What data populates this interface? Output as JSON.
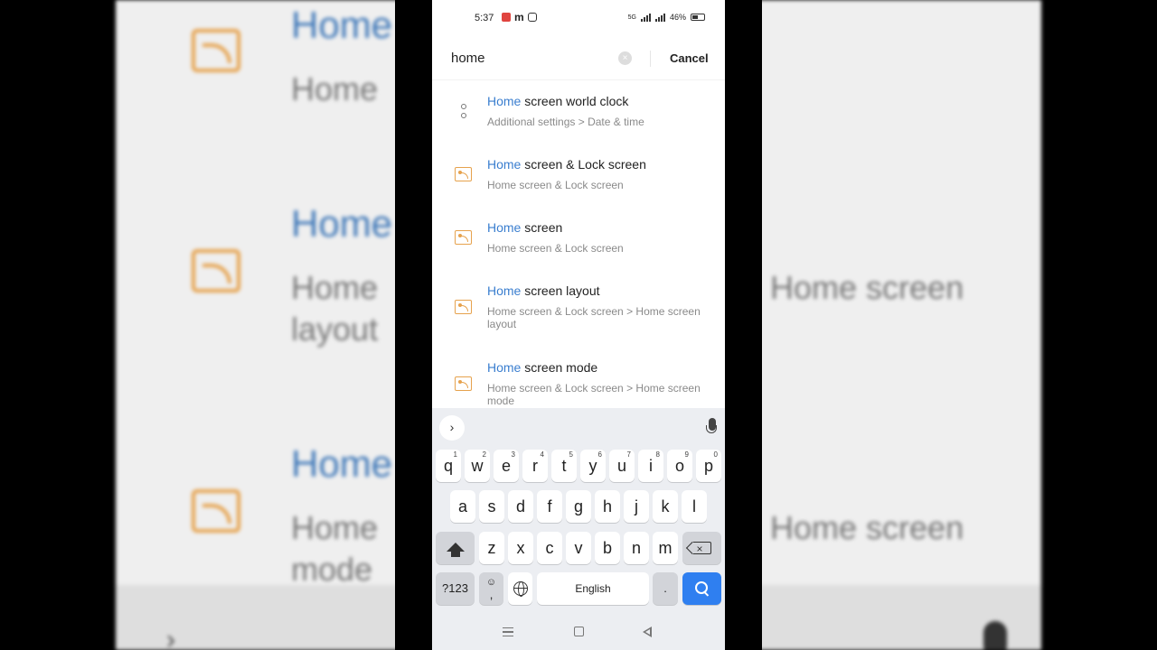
{
  "status_bar": {
    "time": "5:37",
    "notif_letter": "m",
    "battery": "46%",
    "network": "5G"
  },
  "search": {
    "query": "home",
    "clear_glyph": "×",
    "cancel_label": "Cancel"
  },
  "results": [
    {
      "highlight": "Home",
      "rest": " screen world clock",
      "path": "Additional settings > Date & time",
      "icon": "clock-settings-icon"
    },
    {
      "highlight": "Home",
      "rest": " screen & Lock screen",
      "path": "Home screen & Lock screen",
      "icon": "wallpaper-icon"
    },
    {
      "highlight": "Home",
      "rest": " screen",
      "path": "Home screen & Lock screen",
      "icon": "wallpaper-icon"
    },
    {
      "highlight": "Home",
      "rest": " screen layout",
      "path": "Home screen & Lock screen > Home screen layout",
      "icon": "wallpaper-icon"
    },
    {
      "highlight": "Home",
      "rest": " screen mode",
      "path": "Home screen & Lock screen > Home screen mode",
      "icon": "wallpaper-icon"
    }
  ],
  "background": {
    "left_titles": [
      "Home",
      "Home",
      "Home"
    ],
    "left_subs": [
      "Home",
      "Home\nlayout",
      "Home\nmode"
    ],
    "right_subs": [
      "Home screen",
      "Home screen"
    ]
  },
  "keyboard": {
    "toolbar_chevron": "›",
    "row1": [
      {
        "k": "q",
        "h": "1"
      },
      {
        "k": "w",
        "h": "2"
      },
      {
        "k": "e",
        "h": "3"
      },
      {
        "k": "r",
        "h": "4"
      },
      {
        "k": "t",
        "h": "5"
      },
      {
        "k": "y",
        "h": "6"
      },
      {
        "k": "u",
        "h": "7"
      },
      {
        "k": "i",
        "h": "8"
      },
      {
        "k": "o",
        "h": "9"
      },
      {
        "k": "p",
        "h": "0"
      }
    ],
    "row2": [
      "a",
      "s",
      "d",
      "f",
      "g",
      "h",
      "j",
      "k",
      "l"
    ],
    "row3": [
      "z",
      "x",
      "c",
      "v",
      "b",
      "n",
      "m"
    ],
    "sym_label": "?123",
    "emoji_top": "☺",
    "emoji_bottom": ",",
    "space_label": "English",
    "period_label": ".",
    "backspace_x": "×"
  }
}
